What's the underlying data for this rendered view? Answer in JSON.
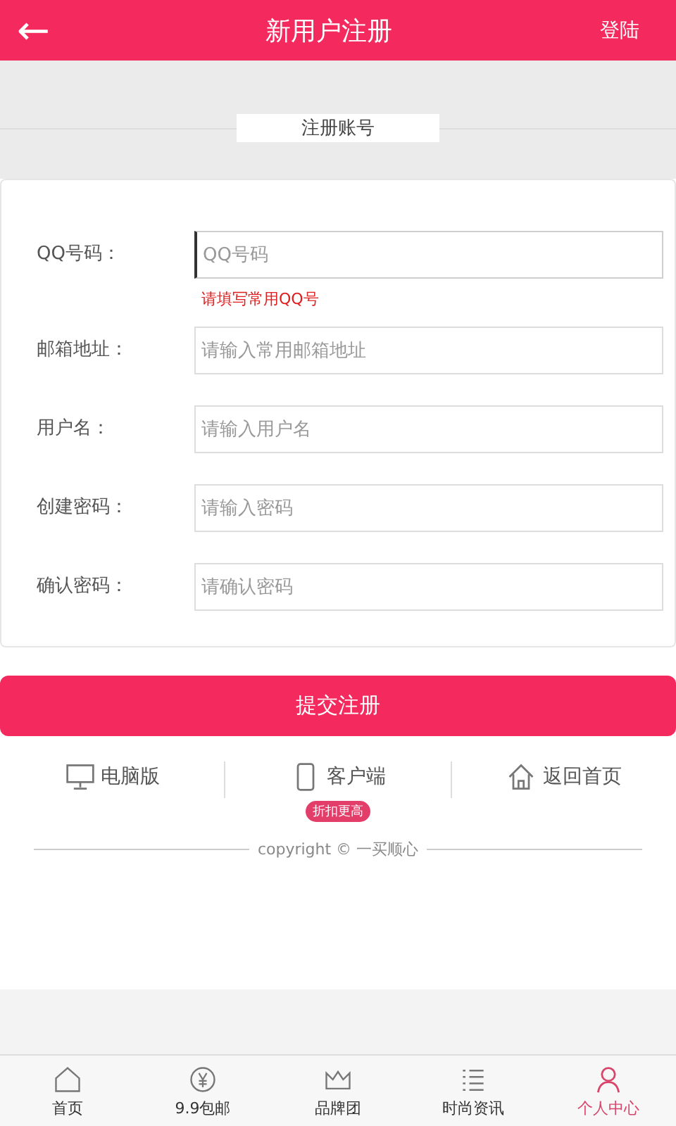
{
  "header": {
    "back": "←",
    "title": "新用户注册",
    "action": "登陆"
  },
  "section_title": "注册账号",
  "fields": [
    {
      "label": "QQ号码：",
      "placeholder": "QQ号码",
      "focused": true,
      "hint": "请填写常用QQ号"
    },
    {
      "label": "邮箱地址：",
      "placeholder": "请输入常用邮箱地址",
      "focused": false
    },
    {
      "label": "用户名：",
      "placeholder": "请输入用户名",
      "focused": false
    },
    {
      "label": "创建密码：",
      "placeholder": "请输入密码",
      "focused": false
    },
    {
      "label": "确认密码：",
      "placeholder": "请确认密码",
      "focused": false
    }
  ],
  "submit": "提交注册",
  "links": [
    {
      "kind": "monitor",
      "label": "电脑版"
    },
    {
      "kind": "phone",
      "label": "客户端",
      "badge": "折扣更高"
    },
    {
      "kind": "house",
      "label": "返回首页"
    }
  ],
  "copyright": "copyright © 一买顺心",
  "tabs": [
    {
      "kind": "home",
      "label": "首页",
      "selected": false
    },
    {
      "kind": "yen",
      "label": "9.9包邮",
      "selected": false
    },
    {
      "kind": "crown",
      "label": "品牌团",
      "selected": false
    },
    {
      "kind": "list",
      "label": "时尚资讯",
      "selected": false
    },
    {
      "kind": "person",
      "label": "个人中心",
      "selected": true
    }
  ]
}
